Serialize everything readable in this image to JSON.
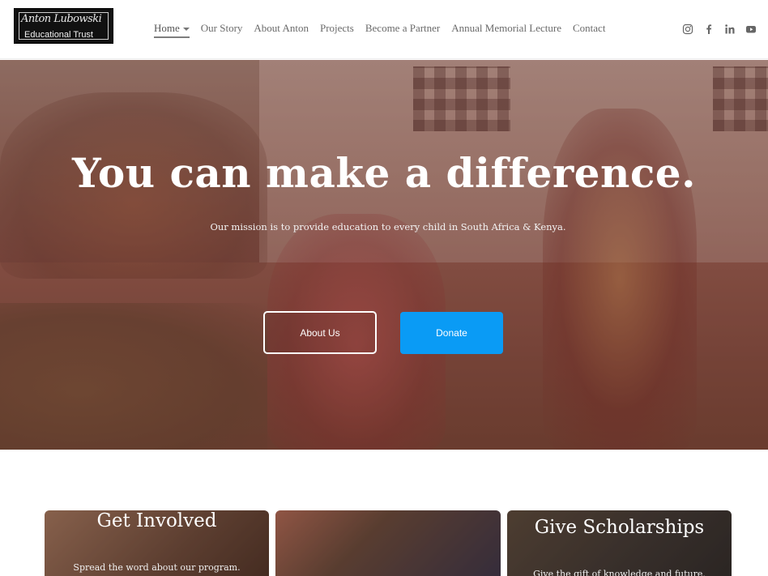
{
  "logo": {
    "script_text": "Anton Lubowski",
    "sub_text": "Educational Trust"
  },
  "nav": {
    "items": [
      {
        "label": "Home",
        "active": true,
        "has_dropdown": true
      },
      {
        "label": "Our Story"
      },
      {
        "label": "About Anton"
      },
      {
        "label": "Projects"
      },
      {
        "label": "Become a Partner"
      },
      {
        "label": "Annual Memorial Lecture"
      },
      {
        "label": "Contact"
      }
    ]
  },
  "social": {
    "icons": [
      "instagram-icon",
      "facebook-icon",
      "linkedin-icon",
      "youtube-icon"
    ]
  },
  "hero": {
    "title": "You can make a difference.",
    "subtitle": "Our mission is to provide education to every child in South Africa  & Kenya.",
    "buttons": {
      "about_label": "About Us",
      "donate_label": "Donate"
    },
    "colors": {
      "donate": "#0a9bf5",
      "overlay": "#6e1e1e"
    }
  },
  "cards": [
    {
      "title": "Get Involved",
      "text": "Spread the word about our program."
    },
    {
      "title": "",
      "text": ""
    },
    {
      "title": "Give Scholarships",
      "text": "Give the gift of knowledge and future."
    }
  ]
}
